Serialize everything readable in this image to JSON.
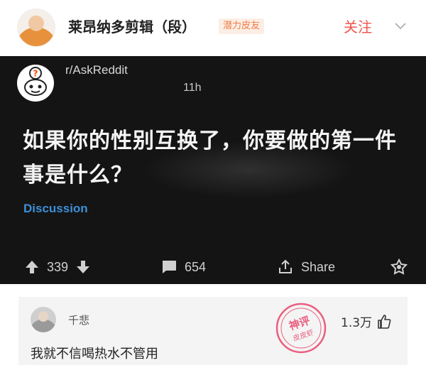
{
  "header": {
    "username": "莱昂纳多剪辑（段）",
    "badge": "潜力皮友",
    "follow_label": "关注"
  },
  "post": {
    "subreddit": "r/AskReddit",
    "time": "11h",
    "title": "如果你的性别互换了，你要做的第一件事是什么？",
    "flair": "Discussion",
    "upvotes": "339",
    "comments": "654",
    "share_label": "Share"
  },
  "comment": {
    "author": "千悲",
    "text": "我就不信喝热水不管用",
    "likes": "1.3万",
    "stamp_text": [
      "神评",
      "皮皮虾"
    ]
  },
  "colors": {
    "follow": "#f0544d",
    "badge_text": "#f07a44",
    "flair": "#3d8fd6",
    "card_bg": "#141414",
    "stamp": "#e8456a"
  }
}
